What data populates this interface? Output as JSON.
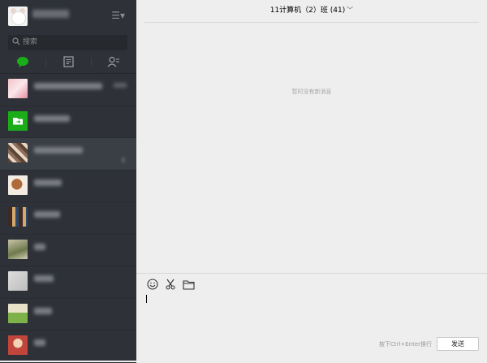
{
  "sidebar": {
    "search": {
      "placeholder": "搜索"
    },
    "tabs": [
      {
        "icon": "chat-bubble-icon",
        "active": true,
        "color": "#1aad19"
      },
      {
        "icon": "articles-icon"
      },
      {
        "icon": "contacts-icon"
      }
    ]
  },
  "chat": {
    "title": "11计算机（2）班 (41)",
    "empty_text": "暂时没有新消息",
    "input_hint": "按下Ctrl+Enter换行",
    "send_label": "发送"
  },
  "colors": {
    "sidebar_bg": "#2e3238",
    "main_bg": "#eeeeee",
    "active_item_bg": "#3a3f45",
    "accent_green": "#1aad19"
  }
}
